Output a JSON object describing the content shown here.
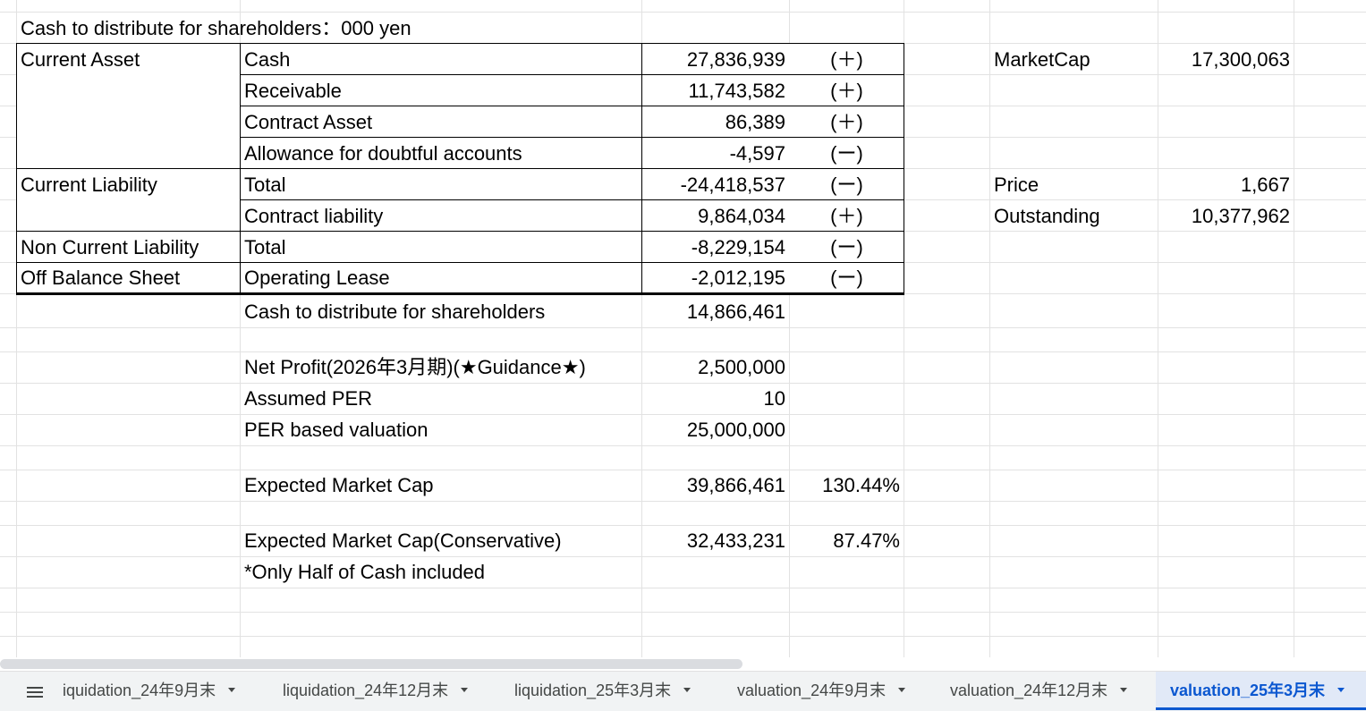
{
  "header": {
    "title": "Cash to distribute for shareholders：000 yen"
  },
  "table": {
    "groups": [
      {
        "label": "Current Asset"
      },
      {
        "label": "Current Liability"
      },
      {
        "label": "Non Current Liability"
      },
      {
        "label": "Off Balance Sheet"
      }
    ],
    "rows": [
      {
        "item": "Cash",
        "value": "27,836,939",
        "sign": "(＋)"
      },
      {
        "item": "Receivable",
        "value": "11,743,582",
        "sign": "(＋)"
      },
      {
        "item": "Contract Asset",
        "value": "86,389",
        "sign": "(＋)"
      },
      {
        "item": "Allowance for doubtful accounts",
        "value": "-4,597",
        "sign": "(ー)"
      },
      {
        "item": "Total",
        "value": "-24,418,537",
        "sign": "(ー)"
      },
      {
        "item": "Contract liability",
        "value": "9,864,034",
        "sign": "(＋)"
      },
      {
        "item": "Total",
        "value": "-8,229,154",
        "sign": "(ー)"
      },
      {
        "item": "Operating Lease",
        "value": "-2,012,195",
        "sign": "(ー)"
      }
    ]
  },
  "summary": {
    "cash_label": "Cash to distribute for shareholders",
    "cash_value": "14,866,461",
    "net_profit_label": "Net Profit(2026年3月期)(★Guidance★)",
    "net_profit_value": "2,500,000",
    "per_label": "Assumed PER",
    "per_value": "10",
    "per_valuation_label": "PER based valuation",
    "per_valuation_value": "25,000,000",
    "expected_label": "Expected Market Cap",
    "expected_value": "39,866,461",
    "expected_pct": "130.44%",
    "conservative_label": "Expected Market Cap(Conservative)",
    "conservative_value": "32,433,231",
    "conservative_pct": "87.47%",
    "note": "*Only Half of Cash included"
  },
  "market": {
    "marketcap_label": "MarketCap",
    "marketcap_value": "17,300,063",
    "price_label": "Price",
    "price_value": "1,667",
    "outstanding_label": "Outstanding",
    "outstanding_value": "10,377,962"
  },
  "sheet_tabs": [
    {
      "label": "iquidation_24年9月末",
      "active": false
    },
    {
      "label": "liquidation_24年12月末",
      "active": false
    },
    {
      "label": "liquidation_25年3月末",
      "active": false
    },
    {
      "label": "valuation_24年9月末",
      "active": false
    },
    {
      "label": "valuation_24年12月末",
      "active": false
    },
    {
      "label": "valuation_25年3月末",
      "active": true
    }
  ],
  "icons": {
    "menu": "menu-icon",
    "tab_dropdown": "chevron-down-icon"
  },
  "colors": {
    "active_tab": "#0b57d0",
    "active_tab_bg": "#e1e9f7",
    "grid": "#e2e2e2",
    "tabbar_bg": "#f1f3f4"
  }
}
